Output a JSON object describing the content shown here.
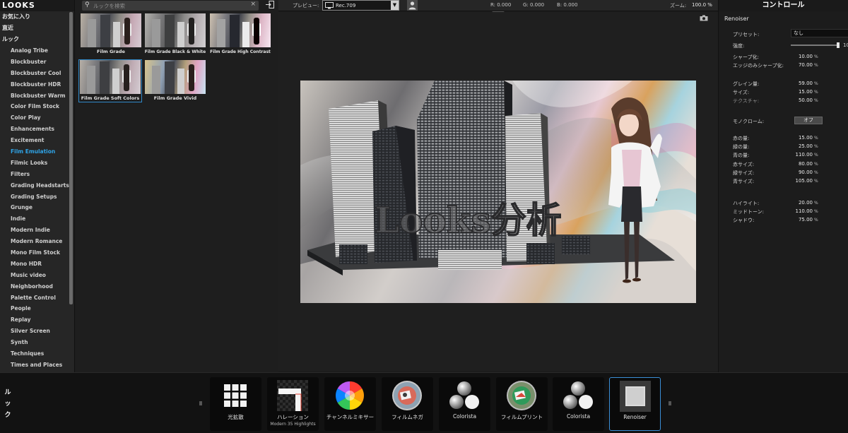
{
  "sidebar": {
    "app_title": "LOOKS",
    "top_items": [
      "お気に入り",
      "直近",
      "ルック"
    ],
    "categories": [
      "Analog Tribe",
      "Blockbuster",
      "Blockbuster Cool",
      "Blockbuster HDR",
      "Blockbuster Warm",
      "Color Film Stock",
      "Color Play",
      "Enhancements",
      "Excitement",
      "Film Emulation",
      "Filmic Looks",
      "Filters",
      "Grading Headstarts",
      "Grading Setups",
      "Grunge",
      "Indie",
      "Modern Indie",
      "Modern Romance",
      "Mono Film Stock",
      "Mono HDR",
      "Music video",
      "Neighborhood",
      "Palette Control",
      "People",
      "Replay",
      "Silver Screen",
      "Synth",
      "Techniques",
      "Times and Places"
    ],
    "active_category": "Film Emulation"
  },
  "browser": {
    "search_placeholder": "ルックを検索",
    "thumbnails": [
      {
        "label": "Film Grade"
      },
      {
        "label": "Film Grade Black & White"
      },
      {
        "label": "Film Grade High Contrast"
      },
      {
        "label": "Film Grade Soft Colors"
      },
      {
        "label": "Film Grade Vivid"
      }
    ],
    "selected": "Film Grade Soft Colors"
  },
  "preview_bar": {
    "preview_label": "プレビュー:",
    "colorspace": "Rec.709",
    "r": "R: 0.000",
    "g": "G: 0.000",
    "b": "B: 0.000",
    "zoom_label": "ズーム:",
    "zoom_value": "100.0 %"
  },
  "preview": {
    "overlay_text": "Looks分析"
  },
  "controls": {
    "header": "コントロール",
    "effect_name": "Renoiser",
    "preset_label": "プリセット:",
    "preset_value": "なし",
    "strength_label": "強度:",
    "strength_value": "10",
    "strength_fraction": 0.98,
    "params_a": [
      {
        "label": "シャープ化:",
        "value": "10.00",
        "unit": "%"
      },
      {
        "label": "エッジのみシャープ化:",
        "value": "70.00",
        "unit": "%"
      }
    ],
    "params_b": [
      {
        "label": "グレイン量:",
        "value": "59.00",
        "unit": "%"
      },
      {
        "label": "サイズ:",
        "value": "15.00",
        "unit": "%"
      },
      {
        "label": "テクスチャ:",
        "value": "50.00",
        "unit": "%",
        "dim": true
      }
    ],
    "mono_label": "モノクローム:",
    "mono_value": "オフ",
    "params_c": [
      {
        "label": "赤の量:",
        "value": "15.00",
        "unit": "%"
      },
      {
        "label": "緑の量:",
        "value": "25.00",
        "unit": "%"
      },
      {
        "label": "青の量:",
        "value": "110.00",
        "unit": "%"
      },
      {
        "label": "赤サイズ:",
        "value": "80.00",
        "unit": "%"
      },
      {
        "label": "緑サイズ:",
        "value": "90.00",
        "unit": "%"
      },
      {
        "label": "青サイズ:",
        "value": "105.00",
        "unit": "%"
      }
    ],
    "params_d": [
      {
        "label": "ハイライト:",
        "value": "20.00",
        "unit": "%"
      },
      {
        "label": "ミッドトーン:",
        "value": "110.00",
        "unit": "%"
      },
      {
        "label": "シャドウ:",
        "value": "75.00",
        "unit": "%"
      }
    ]
  },
  "bottom": {
    "tab_label": [
      "ル",
      "ッ",
      "ク"
    ],
    "effects": [
      {
        "label": "光拡散",
        "sub": "",
        "icon": "grid-icon"
      },
      {
        "label": "ハレーション",
        "sub": "Modern 35 Highlights",
        "icon": "halation-icon"
      },
      {
        "label": "チャンネルミキサー",
        "sub": "",
        "icon": "color-wheel-icon"
      },
      {
        "label": "フィルムネガ",
        "sub": "",
        "icon": "film-negative-icon"
      },
      {
        "label": "Colorista",
        "sub": "",
        "icon": "colorista-icon"
      },
      {
        "label": "フィルムプリント",
        "sub": "",
        "icon": "film-print-icon"
      },
      {
        "label": "Colorista",
        "sub": "",
        "icon": "colorista-icon"
      },
      {
        "label": "Renoiser",
        "sub": "",
        "icon": "renoiser-icon"
      }
    ],
    "selected": "Renoiser"
  },
  "colors": {
    "accent": "#2fa4e7",
    "selection_border": "#3a8ed6"
  }
}
